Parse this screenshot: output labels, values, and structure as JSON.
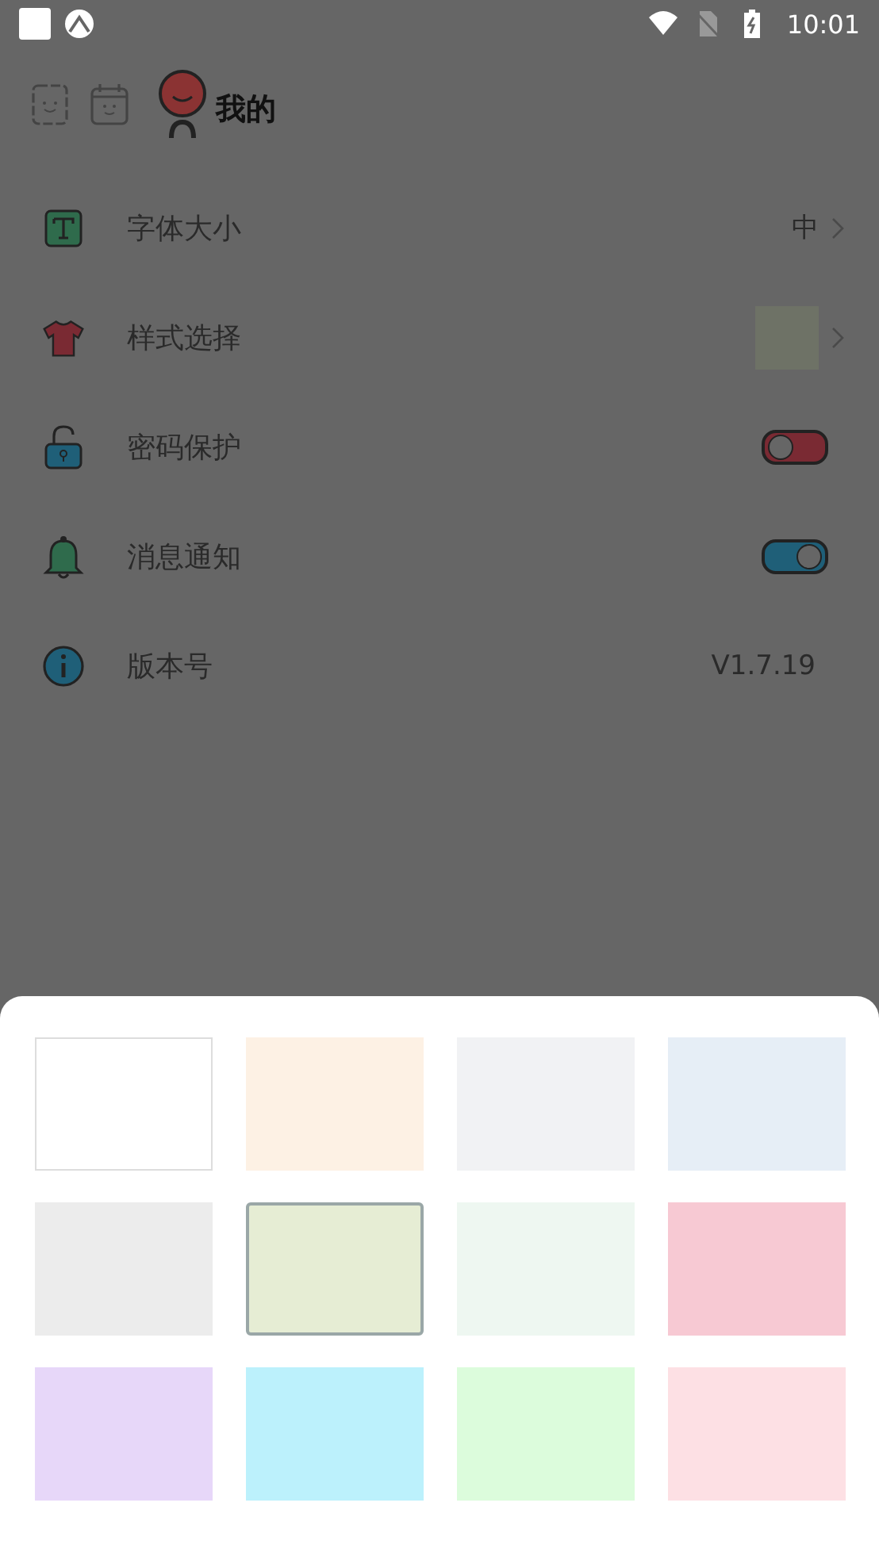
{
  "status_bar": {
    "time": "10:01"
  },
  "header": {
    "title": "我的"
  },
  "settings": [
    {
      "kind": "value",
      "label": "字体大小",
      "value": "中"
    },
    {
      "kind": "thumbnail",
      "label": "样式选择"
    },
    {
      "kind": "toggle",
      "label": "密码保护",
      "on": false
    },
    {
      "kind": "toggle",
      "label": "消息通知",
      "on": true
    },
    {
      "kind": "text",
      "label": "版本号",
      "value": "V1.7.19"
    }
  ],
  "themes": [
    {
      "color": "#ffffff",
      "selected": false
    },
    {
      "color": "#fdf1e4",
      "selected": false
    },
    {
      "color": "#f1f2f4",
      "selected": false
    },
    {
      "color": "#e6eef6",
      "selected": false
    },
    {
      "color": "#ececec",
      "selected": false
    },
    {
      "color": "#e6edd4",
      "selected": true
    },
    {
      "color": "#eef7f1",
      "selected": false
    },
    {
      "color": "#f7c9d3",
      "selected": false
    },
    {
      "color": "#e7d7f9",
      "selected": false
    },
    {
      "color": "#bcf1fc",
      "selected": false
    },
    {
      "color": "#dcfcdc",
      "selected": false
    },
    {
      "color": "#fde0e4",
      "selected": false
    }
  ]
}
